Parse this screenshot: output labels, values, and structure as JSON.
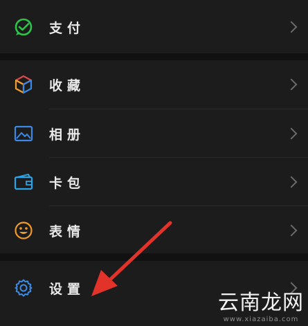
{
  "menu": {
    "pay": {
      "label": "支付",
      "icon": "wechat-pay-icon",
      "color": "#2dc44a"
    },
    "favorites": {
      "label": "收藏",
      "icon": "cube-icon",
      "color": "#e04848"
    },
    "photos": {
      "label": "相册",
      "icon": "picture-icon",
      "color": "#3b89e6"
    },
    "cards": {
      "label": "卡包",
      "icon": "card-icon",
      "color": "#2aa4e8"
    },
    "stickers": {
      "label": "表情",
      "icon": "smiley-icon",
      "color": "#f09a28"
    },
    "settings": {
      "label": "设置",
      "icon": "gear-icon",
      "color": "#3b8de8"
    }
  },
  "annotation": {
    "arrow_color": "#e2332a"
  },
  "watermark": {
    "text": "云南龙网",
    "url": "www.xiazaiba.com"
  }
}
